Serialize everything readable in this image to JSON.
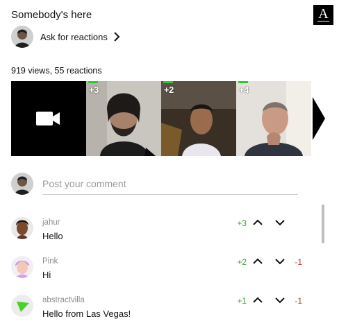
{
  "header": {
    "title": "Somebody's here",
    "logo_letter": "A"
  },
  "ask": {
    "label": "Ask for reactions"
  },
  "stats": {
    "text": "919 views, 55 reactions"
  },
  "strip": {
    "tiles": [
      {
        "count": "+3"
      },
      {
        "count": "+2"
      },
      {
        "count": "+4"
      }
    ]
  },
  "composer": {
    "placeholder": "Post your comment"
  },
  "comments": [
    {
      "user": "jahur",
      "text": "Hello",
      "plus": "+3",
      "minus": ""
    },
    {
      "user": "Pink",
      "text": "Hi",
      "plus": "+2",
      "minus": "-1"
    },
    {
      "user": "abstractvilla",
      "text": "Hello from Las Vegas!",
      "plus": "+1",
      "minus": "-1"
    }
  ],
  "colors": {
    "positive": "#3aa835",
    "negative": "#c0392b",
    "reaction_bar": "#38c438"
  },
  "icons": [
    "video-camera-icon",
    "chevron-right-icon",
    "chevron-up-icon",
    "chevron-down-icon",
    "play-triangle-icon"
  ]
}
